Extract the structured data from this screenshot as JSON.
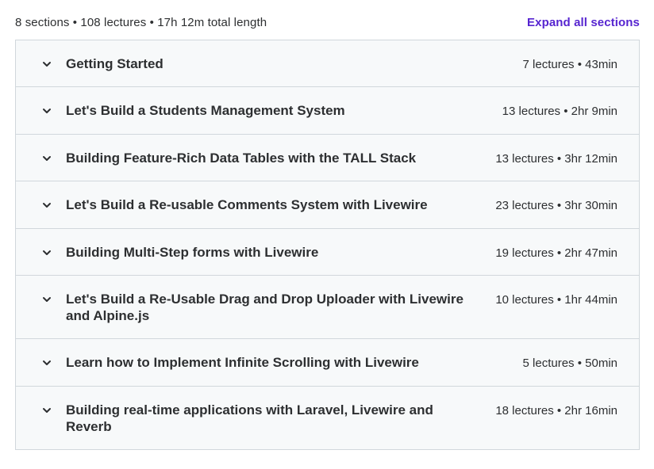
{
  "header": {
    "summary": "8 sections • 108 lectures • 17h 12m total length",
    "expand_all_label": "Expand all sections"
  },
  "sections": [
    {
      "title": "Getting Started",
      "meta": "7 lectures • 43min"
    },
    {
      "title": "Let's Build a Students Management System",
      "meta": "13 lectures • 2hr 9min"
    },
    {
      "title": "Building Feature-Rich Data Tables with the TALL Stack",
      "meta": "13 lectures • 3hr 12min"
    },
    {
      "title": "Let's Build a Re-usable Comments System with Livewire",
      "meta": "23 lectures • 3hr 30min"
    },
    {
      "title": "Building Multi-Step forms with Livewire",
      "meta": "19 lectures • 2hr 47min"
    },
    {
      "title": "Let's Build a Re-Usable Drag and Drop Uploader with Livewire and Alpine.js",
      "meta": "10 lectures • 1hr 44min"
    },
    {
      "title": "Learn how to Implement Infinite Scrolling with Livewire",
      "meta": "5 lectures • 50min"
    },
    {
      "title": "Building real-time applications with Laravel, Livewire and Reverb",
      "meta": "18 lectures • 2hr 16min"
    }
  ],
  "icons": {
    "section_toggle": "chevron-down-icon"
  },
  "colors": {
    "accent": "#5624d0",
    "section_background": "#f7f9fa",
    "border": "#d1d7dc",
    "text": "#2d2f31"
  }
}
